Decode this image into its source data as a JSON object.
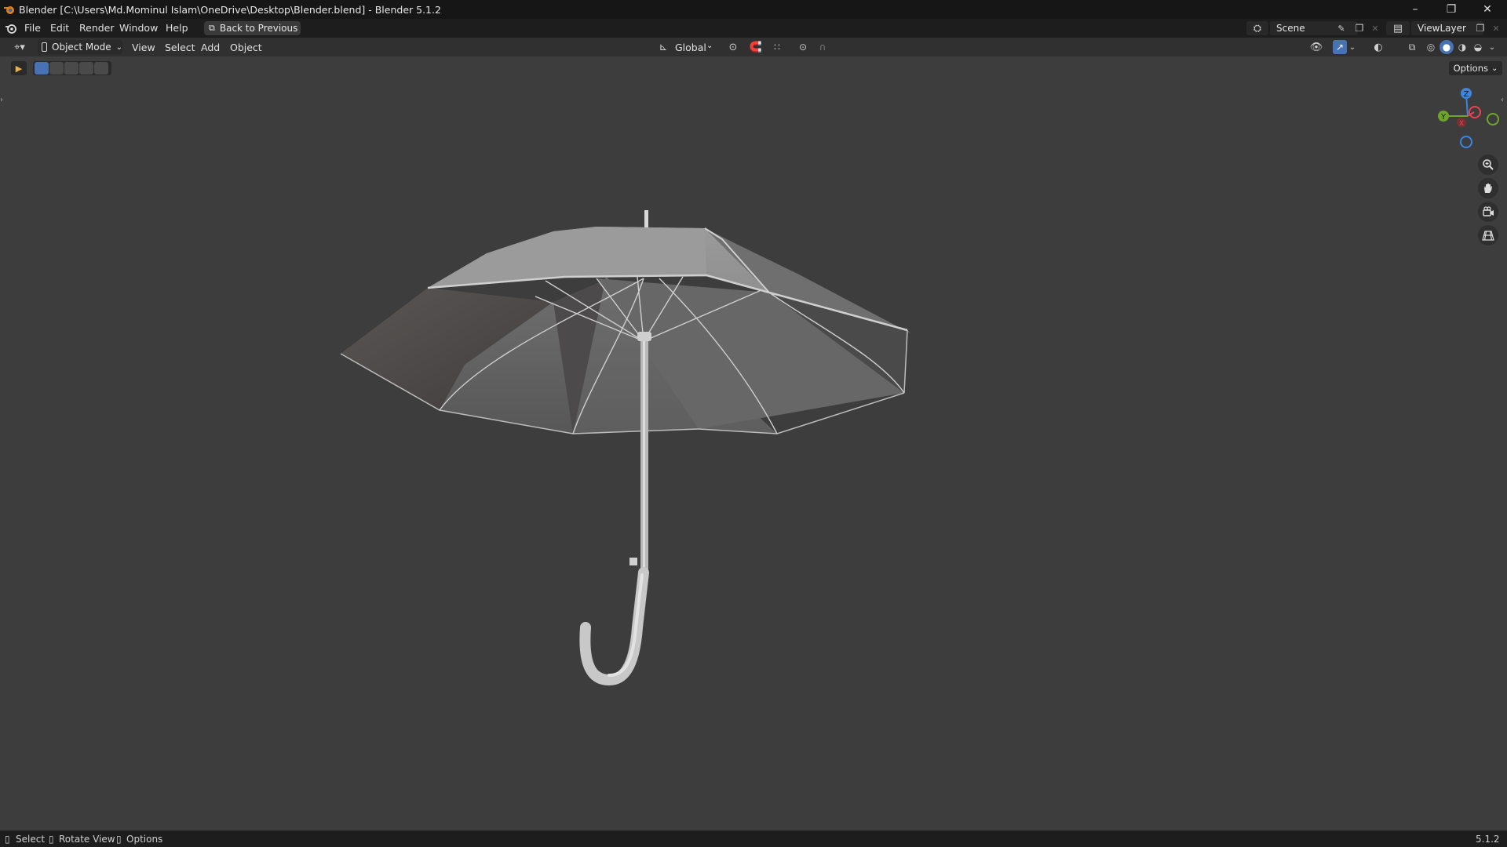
{
  "window": {
    "title": "Blender [C:\\Users\\Md.Mominul Islam\\OneDrive\\Desktop\\Blender.blend] - Blender 5.1.2",
    "controls": {
      "minimize": "–",
      "maximize": "❐",
      "close": "✕"
    }
  },
  "menu": {
    "items": [
      "File",
      "Edit",
      "Render",
      "Window",
      "Help"
    ],
    "back_button": "Back to Previous",
    "scene_label": "Scene",
    "view_layer_label": "ViewLayer"
  },
  "viewport_header": {
    "mode": "Object Mode",
    "menus": [
      "View",
      "Select",
      "Add",
      "Object"
    ],
    "transform_orientation": "Global",
    "options": "Options"
  },
  "gizmo": {
    "axes": {
      "z": "Z",
      "y": "Y",
      "x": "X"
    },
    "colors": {
      "x": "#e8434f",
      "y": "#6ea52a",
      "z": "#3a86e0"
    }
  },
  "statusbar": {
    "select": "Select",
    "rotate": "Rotate View",
    "options": "Options",
    "version": "5.1.2"
  },
  "colors": {
    "background": "#3d3d3d",
    "accent": "#4772b3"
  }
}
